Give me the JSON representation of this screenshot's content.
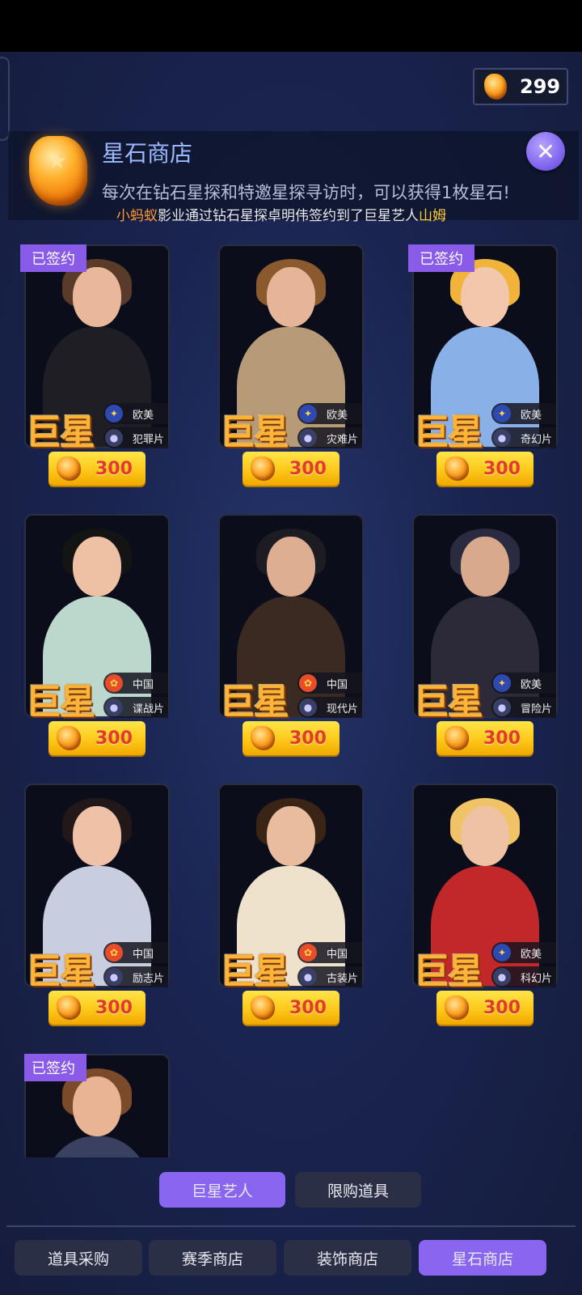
{
  "currency": {
    "icon": "star-stone-icon",
    "value": "299"
  },
  "header": {
    "title": "星石商店",
    "description": "每次在钻石星探和特邀星探寻访时，可以获得1枚星石!",
    "news_part1": "小蚂蚁",
    "news_part2": "影业通过钻石星探卓明伟签约到了巨星艺人",
    "news_part3": "山姆"
  },
  "labels": {
    "signed": "已签约",
    "star": "巨星"
  },
  "cards": [
    {
      "region": "欧美",
      "genre": "犯罪片",
      "price": "300",
      "signed": true,
      "colors": {
        "hair": "#5a3a28",
        "skin": "#e9b89a",
        "outfit": "#1e1e24"
      }
    },
    {
      "region": "欧美",
      "genre": "灾难片",
      "price": "300",
      "signed": false,
      "colors": {
        "hair": "#8a5a2e",
        "skin": "#e6b497",
        "outfit": "#b79b77"
      }
    },
    {
      "region": "欧美",
      "genre": "奇幻片",
      "price": "300",
      "signed": true,
      "colors": {
        "hair": "#f1b43a",
        "skin": "#f2c7ab",
        "outfit": "#8ab0e8"
      }
    },
    {
      "region": "中国",
      "genre": "谍战片",
      "price": "300",
      "signed": false,
      "colors": {
        "hair": "#141414",
        "skin": "#eec0a4",
        "outfit": "#bcd8cc"
      }
    },
    {
      "region": "中国",
      "genre": "现代片",
      "price": "300",
      "signed": false,
      "colors": {
        "hair": "#1c1c22",
        "skin": "#deae92",
        "outfit": "#3a2a22"
      }
    },
    {
      "region": "欧美",
      "genre": "冒险片",
      "price": "300",
      "signed": false,
      "colors": {
        "hair": "#2a2a40",
        "skin": "#d8a98a",
        "outfit": "#2c2a38"
      }
    },
    {
      "region": "中国",
      "genre": "励志片",
      "price": "300",
      "signed": false,
      "colors": {
        "hair": "#22181a",
        "skin": "#efc1a6",
        "outfit": "#c9cde0"
      }
    },
    {
      "region": "中国",
      "genre": "古装片",
      "price": "300",
      "signed": false,
      "colors": {
        "hair": "#3a2416",
        "skin": "#e8bc9c",
        "outfit": "#eee2cc"
      }
    },
    {
      "region": "欧美",
      "genre": "科幻片",
      "price": "300",
      "signed": false,
      "colors": {
        "hair": "#f0c466",
        "skin": "#f0c2a4",
        "outfit": "#c2282a"
      }
    }
  ],
  "partial_card": {
    "signed": true,
    "colors": {
      "hair": "#7a4a2a",
      "skin": "#e8b494",
      "outfit": "#3a4060"
    }
  },
  "sub_tabs": [
    {
      "label": "巨星艺人",
      "active": true
    },
    {
      "label": "限购道具",
      "active": false
    }
  ],
  "bottom_tabs": [
    {
      "label": "道具采购",
      "active": false
    },
    {
      "label": "赛季商店",
      "active": false
    },
    {
      "label": "装饰商店",
      "active": false
    },
    {
      "label": "星石商店",
      "active": true
    }
  ]
}
